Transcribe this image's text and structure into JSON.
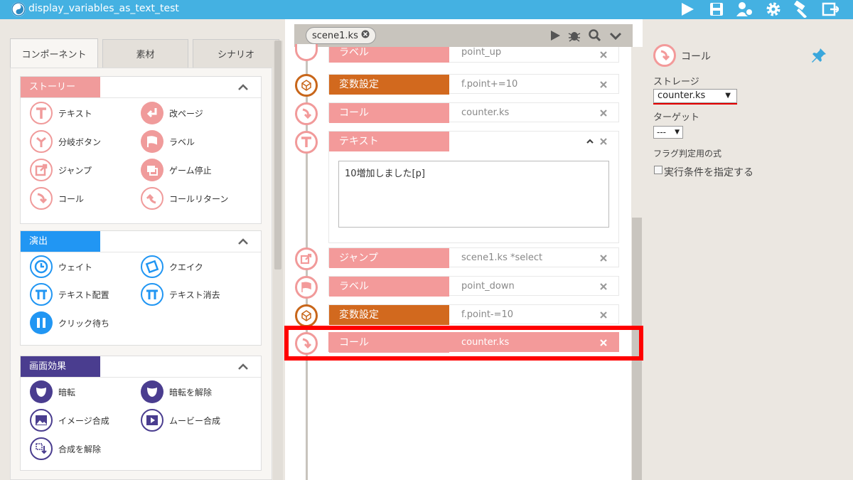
{
  "app": {
    "title": "display_variables_as_text_test"
  },
  "toolbar": {
    "icons": [
      "play-icon",
      "save-icon",
      "users-gear-icon",
      "gear-icon",
      "hammer-icon",
      "export-icon"
    ]
  },
  "left_tabs": [
    "コンポーネント",
    "素材",
    "シナリオ"
  ],
  "categories": {
    "story": {
      "title": "ストーリー",
      "color": "#f09b9b",
      "items": [
        "テキスト",
        "改ページ",
        "分岐ボタン",
        "ラベル",
        "ジャンプ",
        "ゲーム停止",
        "コール",
        "コールリターン"
      ]
    },
    "staging": {
      "title": "演出",
      "color": "#2196f3",
      "items": [
        "ウェイト",
        "クエイク",
        "テキスト配置",
        "テキスト消去",
        "クリック待ち"
      ]
    },
    "screen": {
      "title": "画面効果",
      "color": "#4a3d8f",
      "items": [
        "暗転",
        "暗転を解除",
        "イメージ合成",
        "ムービー合成",
        "合成を解除"
      ]
    }
  },
  "editor": {
    "file_tab": "scene1.ks",
    "rows": [
      {
        "label": "ラベル",
        "value": "point_up"
      },
      {
        "label": "変数設定",
        "value": "f.point+=10"
      },
      {
        "label": "コール",
        "value": "counter.ks"
      },
      {
        "label": "テキスト",
        "value": ""
      },
      {
        "label": "ジャンプ",
        "value": "scene1.ks *select"
      },
      {
        "label": "ラベル",
        "value": "point_down"
      },
      {
        "label": "変数設定",
        "value": "f.point-=10"
      },
      {
        "label": "コール",
        "value": "counter.ks"
      }
    ],
    "text_content": "10増加しました[p]"
  },
  "props": {
    "title": "コール",
    "storage_label": "ストレージ",
    "storage_value": "counter.ks",
    "target_label": "ターゲット",
    "target_value": "---",
    "flag_label": "フラグ判定用の式",
    "condition_label": "実行条件を指定する"
  },
  "colors": {
    "accent": "#44b1e2",
    "pink": "#f39a9a",
    "orange": "#d2691e",
    "highlight": "#ff0000"
  }
}
